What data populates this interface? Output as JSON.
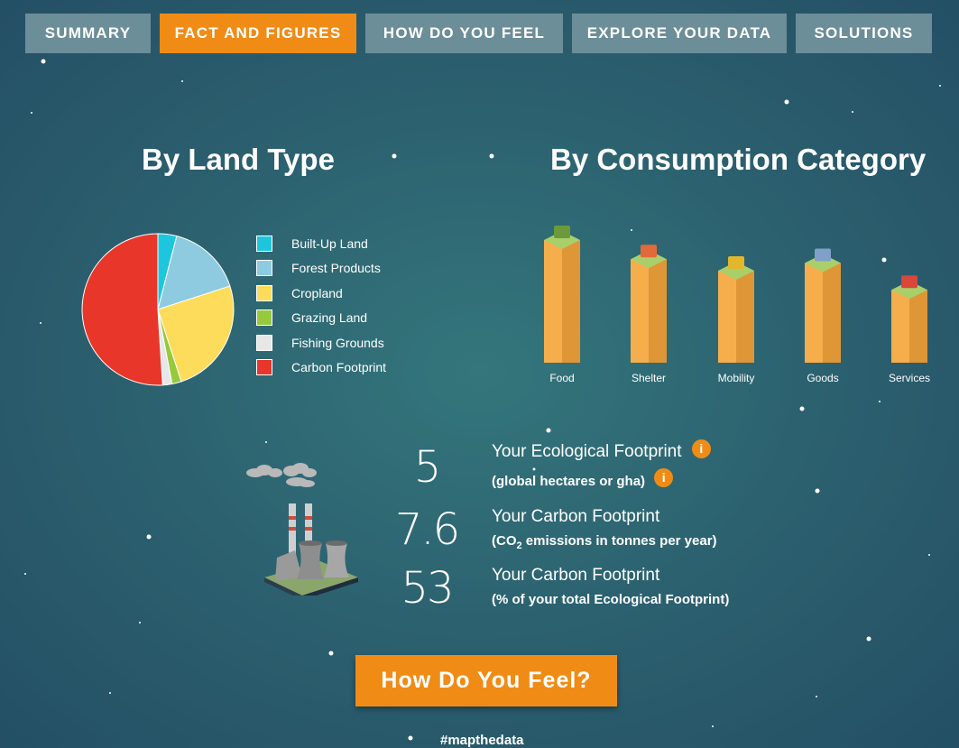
{
  "nav": {
    "tabs": [
      {
        "label": "SUMMARY",
        "active": false
      },
      {
        "label": "FACT AND FIGURES",
        "active": true
      },
      {
        "label": "HOW DO YOU FEEL",
        "active": false
      },
      {
        "label": "EXPLORE YOUR DATA",
        "active": false
      },
      {
        "label": "SOLUTIONS",
        "active": false
      }
    ]
  },
  "land_type": {
    "heading": "By Land Type",
    "legend": [
      {
        "label": "Built-Up Land",
        "color": "#1ec6dd"
      },
      {
        "label": "Forest Products",
        "color": "#8fcbe0"
      },
      {
        "label": "Cropland",
        "color": "#fddc5c"
      },
      {
        "label": "Grazing Land",
        "color": "#97c93c"
      },
      {
        "label": "Fishing Grounds",
        "color": "#e7e7e7"
      },
      {
        "label": "Carbon Footprint",
        "color": "#e8362a"
      }
    ]
  },
  "consumption": {
    "heading": "By Consumption Category",
    "categories": [
      "Food",
      "Shelter",
      "Mobility",
      "Goods",
      "Services"
    ]
  },
  "stats": {
    "eco": {
      "value": "5",
      "title": "Your Ecological Footprint",
      "subtitle": "(global hectares or gha)",
      "info_icon": "i"
    },
    "carbon": {
      "value": "7.6",
      "title": "Your Carbon Footprint",
      "subtitle_pre": "(CO",
      "subtitle_sub": "2",
      "subtitle_post": " emissions in tonnes per year)"
    },
    "percent": {
      "value": "53",
      "title": "Your Carbon Footprint",
      "subtitle": "(% of your total Ecological Footprint)"
    }
  },
  "cta": {
    "label": "How Do You Feel?"
  },
  "hashtag": "#mapthedata",
  "chart_data": [
    {
      "type": "pie",
      "title": "By Land Type",
      "categories": [
        "Built-Up Land",
        "Forest Products",
        "Cropland",
        "Grazing Land",
        "Fishing Grounds",
        "Carbon Footprint"
      ],
      "values": [
        4,
        16,
        25,
        2,
        2,
        51
      ],
      "colors": [
        "#1ec6dd",
        "#8fcbe0",
        "#fddc5c",
        "#97c93c",
        "#e7e7e7",
        "#e8362a"
      ],
      "legend_position": "right"
    },
    {
      "type": "bar",
      "title": "By Consumption Category",
      "categories": [
        "Food",
        "Shelter",
        "Mobility",
        "Goods",
        "Services"
      ],
      "values": [
        1.6,
        1.35,
        1.2,
        1.3,
        0.95
      ]
    }
  ]
}
